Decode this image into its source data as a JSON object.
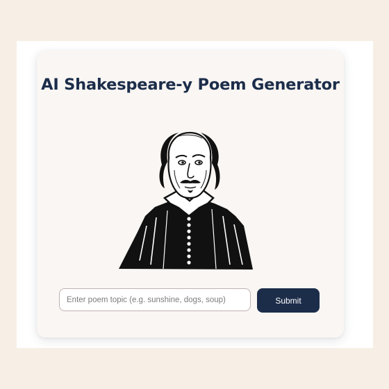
{
  "header": {
    "title": "AI Shakespeare-y Poem Generator"
  },
  "portrait": {
    "icon": "shakespeare-portrait-icon"
  },
  "form": {
    "topic_placeholder": "Enter poem topic (e.g. sunshine, dogs, soup)",
    "topic_value": "",
    "submit_label": "Submit"
  },
  "colors": {
    "page_background": "#f7efe6",
    "frame_background": "#ffffff",
    "card_background": "#f9f6f3",
    "accent": "#1c2d4a",
    "input_border": "#bfb2b2"
  }
}
